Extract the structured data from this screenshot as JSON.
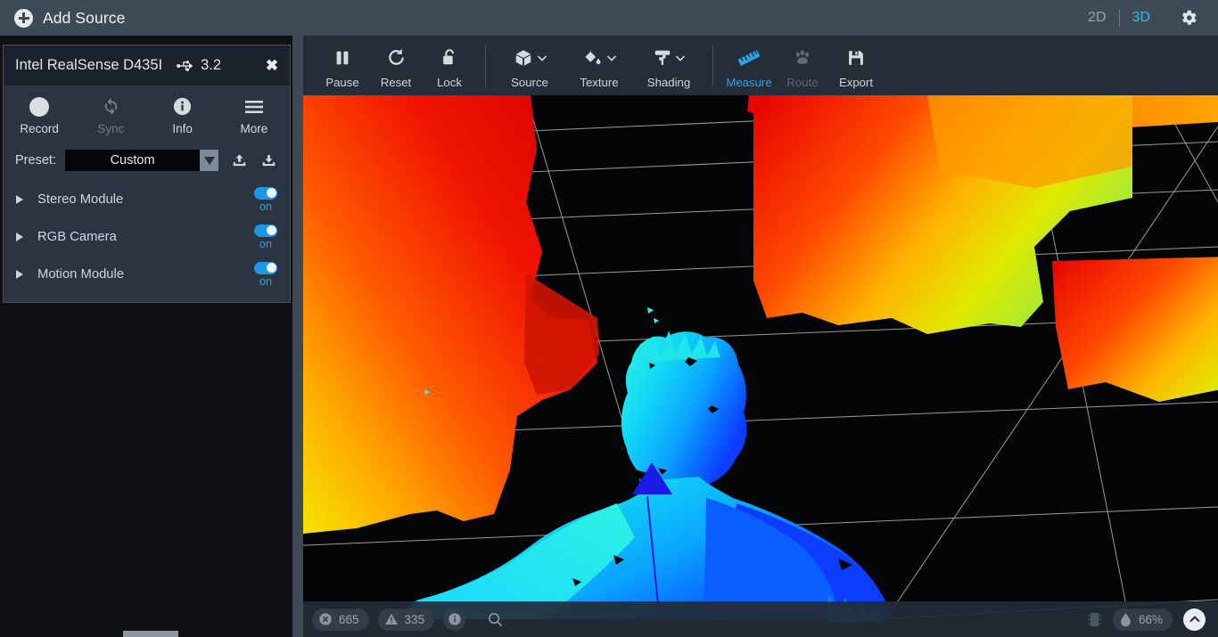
{
  "topbar": {
    "add_source_label": "Add Source",
    "add_icon": "plus-circle-icon",
    "view_2d": "2D",
    "view_3d": "3D",
    "active_view": "3D",
    "settings_icon": "gear-icon",
    "accent_color": "#3cb6ea",
    "background": "#3e4a56"
  },
  "device_panel": {
    "name": "Intel RealSense D435I",
    "usb_icon": "usb-icon",
    "usb_version": "3.2",
    "close_icon": "close-icon",
    "actions": [
      {
        "label": "Record",
        "icon": "record-circle-icon",
        "enabled": true
      },
      {
        "label": "Sync",
        "icon": "sync-refresh-icon",
        "enabled": false
      },
      {
        "label": "Info",
        "icon": "info-circle-icon",
        "enabled": true
      },
      {
        "label": "More",
        "icon": "hamburger-menu-icon",
        "enabled": true
      }
    ],
    "preset": {
      "label": "Preset:",
      "value": "Custom",
      "dropdown_icon": "chevron-down-icon",
      "upload_icon": "upload-icon",
      "download_icon": "download-icon"
    },
    "modules": [
      {
        "name": "Stereo Module",
        "state": "on",
        "expanded": false
      },
      {
        "name": "RGB Camera",
        "state": "on",
        "expanded": false
      },
      {
        "name": "Motion Module",
        "state": "on",
        "expanded": false
      }
    ],
    "toggle_color": "#1e96e8"
  },
  "viewport_toolbar": {
    "tools": [
      {
        "label": "Pause",
        "icon": "pause-icon",
        "state": "normal",
        "dropdown": false
      },
      {
        "label": "Reset",
        "icon": "reset-rotate-icon",
        "state": "normal",
        "dropdown": false
      },
      {
        "label": "Lock",
        "icon": "unlocked-padlock-icon",
        "state": "normal",
        "dropdown": false
      },
      {
        "label": "Source",
        "icon": "cube-icon",
        "state": "normal",
        "dropdown": true
      },
      {
        "label": "Texture",
        "icon": "paint-bucket-icon",
        "state": "normal",
        "dropdown": true
      },
      {
        "label": "Shading",
        "icon": "paint-roller-icon",
        "state": "normal",
        "dropdown": true
      },
      {
        "label": "Measure",
        "icon": "ruler-icon",
        "state": "active",
        "dropdown": false
      },
      {
        "label": "Route",
        "icon": "paw-prints-icon",
        "state": "disabled",
        "dropdown": false
      },
      {
        "label": "Export",
        "icon": "floppy-save-icon",
        "state": "normal",
        "dropdown": false
      }
    ]
  },
  "statusbar": {
    "error_icon": "error-x-circle-icon",
    "error_count": "665",
    "warning_icon": "warning-triangle-icon",
    "warning_count": "335",
    "info_icon": "info-circle-icon",
    "search_icon": "search-icon",
    "chip_icon": "cpu-chip-icon",
    "humidity_icon": "droplet-icon",
    "humidity_value": "66%",
    "collapse_icon": "chevron-up-circle-icon"
  },
  "scene": {
    "description": "3D point cloud of a person in a room rendered with jet depth colormap on black background with perspective grid",
    "measure_marker": "blue-triangle-measure-marker",
    "grid_color": "#b9bcc0",
    "background_color": "#040507"
  }
}
